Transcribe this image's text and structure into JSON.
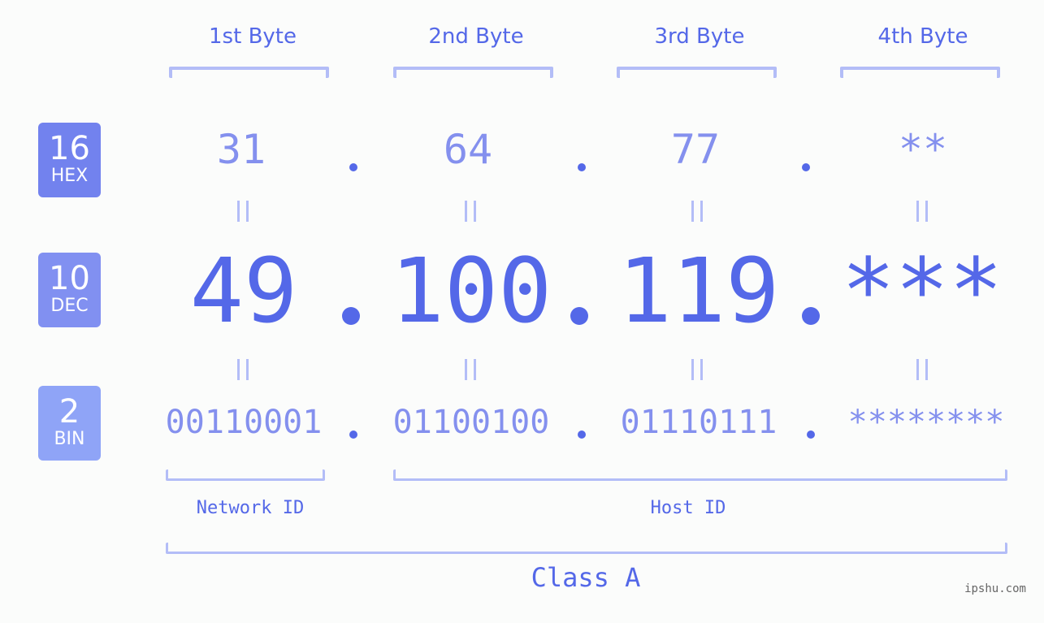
{
  "bytes": [
    {
      "title": "1st Byte",
      "hex": "31",
      "dec": "49",
      "bin": "00110001"
    },
    {
      "title": "2nd Byte",
      "hex": "64",
      "dec": "100",
      "bin": "01100100"
    },
    {
      "title": "3rd Byte",
      "hex": "77",
      "dec": "119",
      "bin": "01110111"
    },
    {
      "title": "4th Byte",
      "hex": "**",
      "dec": "***",
      "bin": "********"
    }
  ],
  "bases": [
    {
      "num": "16",
      "label": "HEX",
      "color": "#7282ee"
    },
    {
      "num": "10",
      "label": "DEC",
      "color": "#8190f1"
    },
    {
      "num": "2",
      "label": "BIN",
      "color": "#8fa4f7"
    }
  ],
  "separator": ".",
  "network_id_label": "Network ID",
  "host_id_label": "Host ID",
  "class_label": "Class A",
  "watermark": "ipshu.com",
  "colors": {
    "accent": "#5468e8",
    "secondary": "#8490ee",
    "bracket": "#b3bdf7",
    "background": "#fbfcfb"
  }
}
